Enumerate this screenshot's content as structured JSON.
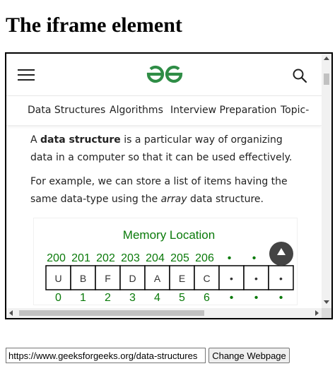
{
  "page": {
    "title": "The iframe element"
  },
  "iframe": {
    "header": {
      "menu_icon": "hamburger-menu-icon",
      "logo_icon": "geeksforgeeks-logo-icon",
      "search_icon": "search-icon",
      "brand_color": "#2f8d46"
    },
    "nav": {
      "items": [
        "Data Structures",
        "Algorithms",
        "Interview Preparation",
        "Topic-"
      ]
    },
    "article": {
      "p1": {
        "before": "A ",
        "bold": "data structure",
        "after": " is a particular way of organizing data in a computer so that it can be used effectively."
      },
      "p2": {
        "before": "For example, we can store a list of items having the same data-type using the ",
        "italic": "array",
        "after": " data structure."
      }
    },
    "diagram": {
      "title": "Memory Location",
      "addresses": [
        "200",
        "201",
        "202",
        "203",
        "204",
        "205",
        "206",
        "•",
        "•"
      ],
      "cells": [
        "U",
        "B",
        "F",
        "D",
        "A",
        "E",
        "C",
        "•",
        "•",
        "•"
      ],
      "indices": [
        "0",
        "1",
        "2",
        "3",
        "4",
        "5",
        "6",
        "•",
        "•",
        "•"
      ],
      "color": "#0a7a0a"
    },
    "scroll_top_icon": "chevron-up-icon"
  },
  "controls": {
    "url_value": "https://www.geeksforgeeks.org/data-structures",
    "button_label": "Change Webpage"
  }
}
